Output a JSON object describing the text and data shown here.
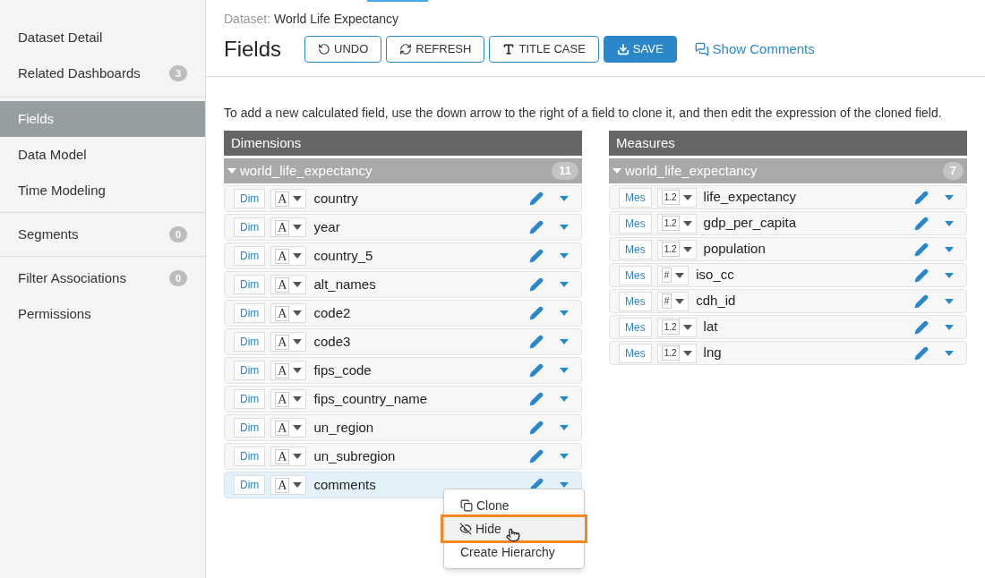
{
  "sidebar": {
    "groups": [
      {
        "items": [
          {
            "label": "Dataset Detail",
            "selected": false
          },
          {
            "label": "Related Dashboards",
            "count": "3",
            "selected": false
          }
        ]
      },
      {
        "items": [
          {
            "label": "Fields",
            "selected": true
          },
          {
            "label": "Data Model",
            "selected": false
          },
          {
            "label": "Time Modeling",
            "selected": false
          }
        ]
      },
      {
        "items": [
          {
            "label": "Segments",
            "count": "0",
            "selected": false
          }
        ]
      },
      {
        "items": [
          {
            "label": "Filter Associations",
            "count": "0",
            "selected": false
          },
          {
            "label": "Permissions",
            "selected": false
          }
        ]
      }
    ]
  },
  "breadcrumb": {
    "label": "Dataset:",
    "value": "World Life Expectancy"
  },
  "title": "Fields",
  "toolbar": [
    {
      "kind": "undo",
      "label": "UNDO"
    },
    {
      "kind": "refresh",
      "label": "REFRESH"
    },
    {
      "kind": "title_case",
      "label": "TITLE CASE"
    },
    {
      "kind": "save",
      "label": "SAVE"
    }
  ],
  "show_comments": "Show Comments",
  "instruction": "To add a new calculated field, use the down arrow to the right of a field to clone it, and then edit the expression of the cloned field.",
  "panels": [
    {
      "title": "Dimensions",
      "group": {
        "name": "world_life_expectancy",
        "count": "11",
        "expanded": true
      },
      "fields": [
        {
          "role": "Dim",
          "type_label": "A",
          "name": "country",
          "selected": false
        },
        {
          "role": "Dim",
          "type_label": "A",
          "name": "year",
          "selected": false
        },
        {
          "role": "Dim",
          "type_label": "A",
          "name": "country_5",
          "selected": false
        },
        {
          "role": "Dim",
          "type_label": "A",
          "name": "alt_names",
          "selected": false
        },
        {
          "role": "Dim",
          "type_label": "A",
          "name": "code2",
          "selected": false
        },
        {
          "role": "Dim",
          "type_label": "A",
          "name": "code3",
          "selected": false
        },
        {
          "role": "Dim",
          "type_label": "A",
          "name": "fips_code",
          "selected": false
        },
        {
          "role": "Dim",
          "type_label": "A",
          "name": "fips_country_name",
          "selected": false
        },
        {
          "role": "Dim",
          "type_label": "A",
          "name": "un_region",
          "selected": false
        },
        {
          "role": "Dim",
          "type_label": "A",
          "name": "un_subregion",
          "selected": false
        },
        {
          "role": "Dim",
          "type_label": "A",
          "name": "comments",
          "selected": true
        }
      ]
    },
    {
      "title": "Measures",
      "group": {
        "name": "world_life_expectancy",
        "count": "7",
        "expanded": true
      },
      "fields": [
        {
          "role": "Mes",
          "type_label": "1.2",
          "name": "life_expectancy",
          "selected": false
        },
        {
          "role": "Mes",
          "type_label": "1.2",
          "name": "gdp_per_capita",
          "selected": false
        },
        {
          "role": "Mes",
          "type_label": "1.2",
          "name": "population",
          "selected": false
        },
        {
          "role": "Mes",
          "type_label": "#",
          "name": "iso_cc",
          "selected": false
        },
        {
          "role": "Mes",
          "type_label": "#",
          "name": "cdh_id",
          "selected": false
        },
        {
          "role": "Mes",
          "type_label": "1.2",
          "name": "lat",
          "selected": false
        },
        {
          "role": "Mes",
          "type_label": "1.2",
          "name": "lng",
          "selected": false
        }
      ]
    }
  ],
  "context_menu": {
    "items": [
      {
        "kind": "clone",
        "label": "Clone",
        "selected": false
      },
      {
        "kind": "hide",
        "label": "Hide",
        "selected": true
      },
      {
        "kind": "plain",
        "label": "Create Hierarchy",
        "selected": false
      }
    ]
  }
}
